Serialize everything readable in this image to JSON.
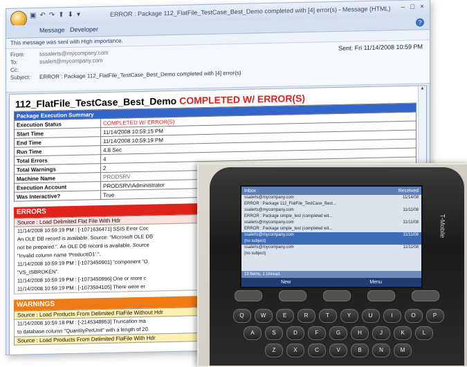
{
  "window": {
    "title": "ERROR : Package 112_FlatFile_TestCase_Best_Demo completed with [4] error(s) - Message (HTML)",
    "controls": [
      "–",
      "□",
      "×"
    ]
  },
  "ribbon": {
    "tabs": [
      "Message",
      "Developer"
    ]
  },
  "infobar": {
    "text": "This message was sent with High importance."
  },
  "header": {
    "from_label": "From:",
    "from_value": "sssalerts@mycompany.com",
    "to_label": "To:",
    "to_value": "ssalert@mycompany.com",
    "cc_label": "Cc:",
    "cc_value": "",
    "subject_label": "Subject:",
    "subject_value": "ERROR : Package 112_FlatFile_TestCase_Best_Demo completed with [4] error(s)",
    "sent_label": "Sent:",
    "sent_value": "Fri 11/14/2008 10:59 PM"
  },
  "summary": {
    "package_name": "112_FlatFile_TestCase_Best_Demo",
    "status_title": "COMPLETED W/ ERROR(S)",
    "section_title": "Package Execution Summary",
    "rows": [
      {
        "k": "Execution Status",
        "v": "COMPLETED W/ ERROR(S)"
      },
      {
        "k": "Start Time",
        "v": "11/14/2008 10:59:15 PM"
      },
      {
        "k": "End Time",
        "v": "11/14/2008 10:59:19 PM"
      },
      {
        "k": "Run Time",
        "v": "4.8 Sec"
      },
      {
        "k": "Total Errors",
        "v": "4"
      },
      {
        "k": "Total Warnings",
        "v": "2"
      },
      {
        "k": "Machine Name",
        "v": "PRODSRV"
      },
      {
        "k": "Execution Account",
        "v": "PRODSRV\\Administrator"
      },
      {
        "k": "Was Interactive?",
        "v": "True"
      }
    ]
  },
  "errors": {
    "title": "ERRORS",
    "source": "Source : Load Delimited Flat File With Hdr",
    "messages": [
      "11/14/2008 10:59:19 PM : [-1071636471] SSIS Error Coc",
      "An OLE DB record is available. Source: \"Microsoft OLE DB",
      "not be prepared.\". An OLE DB record is available. Source",
      "\"Invalid column name 'ProductID1'.\".",
      "11/14/2008 10:59:19 PM : [-1073450901] \"component \"O",
      "\"VS_ISBROKEN\".",
      "11/14/2008 10:59:19 PM : [-1073450996] One or more c",
      "11/14/2008 10:59:19 PM : [-1073594105] There were er"
    ]
  },
  "warnings": {
    "title": "WARNINGS",
    "source1": "Source : Load Products From Delimited FlaFile Without Hdr",
    "messages": [
      "11/14/2008 10:59:18 PM : [-2145348953] Truncation ma",
      "to database column \"QuantityPerUnit\" with a length of 20."
    ],
    "source2": "Source : Load Products From Delimited FlaFile With Hdr"
  },
  "phone": {
    "status_bar": "Inbox",
    "sort_label": "Received",
    "rows": [
      {
        "from": "ssalerts@mycompany.com",
        "time": "11/14/08"
      },
      {
        "from": "ERROR : Package 112_FlatFile_TestCase_Best...",
        "time": ""
      },
      {
        "from": "ssalerts@mycompany.com",
        "time": "11/11/08"
      },
      {
        "from": "ERROR : Package simple_test (completed wit...",
        "time": ""
      },
      {
        "from": "ssalerts@mycompany.com",
        "time": "11/11/08"
      },
      {
        "from": "ERROR : Package simple_test (completed wit...",
        "time": ""
      },
      {
        "from": "ssalerts@mycompany.com",
        "time": "11/11/08"
      },
      {
        "from": "(no subject)",
        "time": ""
      },
      {
        "from": "ssalerts@mycompany.com",
        "time": "11/11/08"
      },
      {
        "from": "(no subject)",
        "time": ""
      }
    ],
    "footer": "19 Items, 1 Unread.",
    "softkey_left": "New",
    "softkey_right": "Menu",
    "brand": "T-Mobile",
    "keyboard": [
      [
        "Q",
        "W",
        "E",
        "R",
        "T",
        "Y",
        "U",
        "I",
        "O",
        "P"
      ],
      [
        "A",
        "S",
        "D",
        "F",
        "G",
        "H",
        "J",
        "K",
        "L"
      ],
      [
        "Z",
        "X",
        "C",
        "V",
        "B",
        "N",
        "M"
      ]
    ]
  }
}
